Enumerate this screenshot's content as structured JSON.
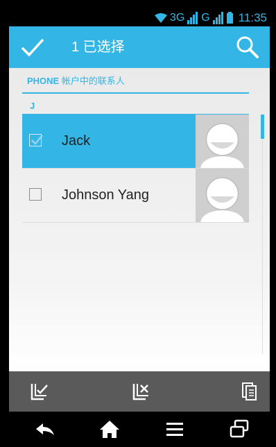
{
  "status_bar": {
    "network_1": "3G",
    "network_2": "G",
    "time": "11:35"
  },
  "action_bar": {
    "title": "1 已选择",
    "confirm_icon": "check-icon",
    "search_icon": "search-icon"
  },
  "account": {
    "header_bold": "PHONE",
    "header_rest": " 帐户中的联系人"
  },
  "section": {
    "letter": "J"
  },
  "contacts": [
    {
      "name": "Jack",
      "checked": true
    },
    {
      "name": "Johnson Yang",
      "checked": false
    }
  ],
  "bottom_toolbar": {
    "icons": [
      "select-all-icon",
      "deselect-all-icon",
      "copy-icon"
    ]
  },
  "nav_bar": {
    "icons": [
      "back-icon",
      "home-icon",
      "menu-icon",
      "recent-apps-icon"
    ]
  },
  "colors": {
    "accent": "#33b5e5",
    "toolbar": "#5a5a5a",
    "avatar_bg": "#cfcfcf"
  }
}
